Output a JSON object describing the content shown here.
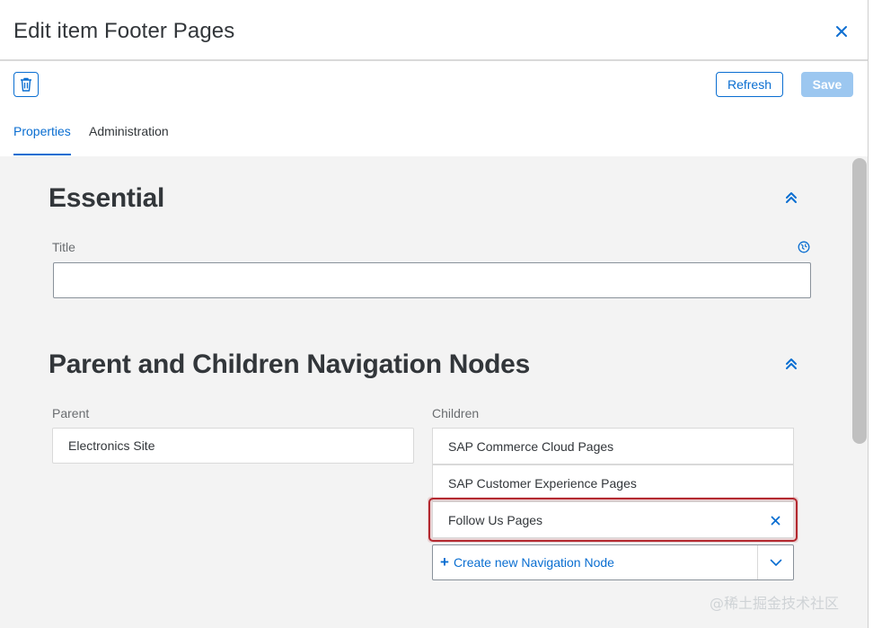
{
  "dialog": {
    "title": "Edit item Footer Pages"
  },
  "toolbar": {
    "refresh_label": "Refresh",
    "save_label": "Save"
  },
  "tabs": [
    {
      "label": "Properties",
      "active": true
    },
    {
      "label": "Administration",
      "active": false
    }
  ],
  "sections": {
    "essential": {
      "title": "Essential",
      "title_field_label": "Title",
      "title_value": ""
    },
    "navigation": {
      "title": "Parent and Children Navigation Nodes",
      "parent_label": "Parent",
      "parent_value": "Electronics Site",
      "children_label": "Children",
      "children": [
        {
          "label": "SAP Commerce Cloud Pages"
        },
        {
          "label": "SAP Customer Experience Pages"
        },
        {
          "label": "Follow Us Pages",
          "highlighted": true
        }
      ],
      "create_label": "Create new Navigation Node"
    }
  },
  "watermark": "@稀土掘金技术社区",
  "icons": {
    "close": "close-icon",
    "delete": "trash-icon",
    "collapse": "double-chevron-up-icon",
    "globe": "globe-icon",
    "remove": "close-icon",
    "dropdown": "chevron-down-icon",
    "add": "plus-icon"
  },
  "colors": {
    "accent": "#0a6ed1",
    "save_disabled": "#9cc7f0",
    "highlight_border": "#b3282f",
    "content_bg": "#f3f3f3"
  }
}
